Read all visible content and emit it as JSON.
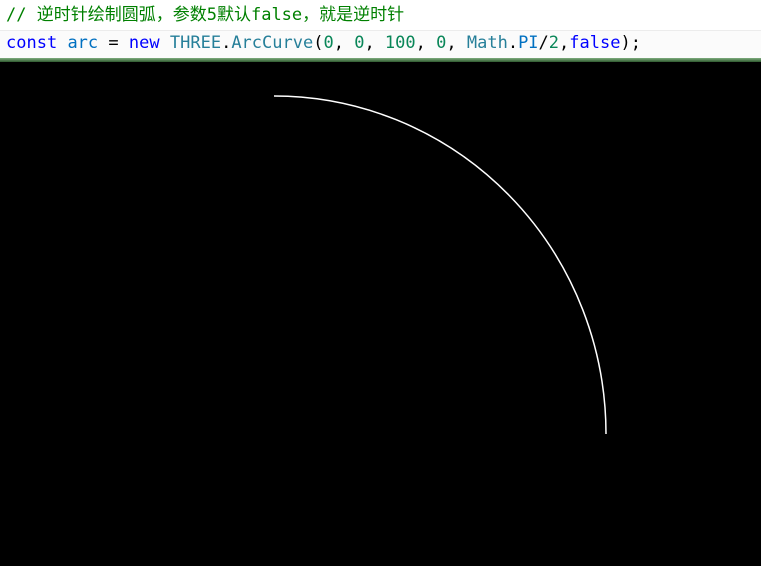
{
  "code": {
    "comment": {
      "prefix": "// ",
      "text1": "逆时针绘制圆弧，参数",
      "num": "5",
      "text2": "默认",
      "kw": "false",
      "text3": "，就是逆时针"
    },
    "statement": {
      "keyword_const": "const",
      "var_name": "arc",
      "equals": "=",
      "keyword_new": "new",
      "namespace": "THREE",
      "dot1": ".",
      "class_name": "ArcCurve",
      "open_paren": "(",
      "arg1": "0",
      "arg2": "0",
      "arg3": "100",
      "arg4": "0",
      "math_obj": "Math",
      "dot2": ".",
      "math_prop": "PI",
      "slash": "/",
      "divisor": "2",
      "comma": ",",
      "last_arg": "false",
      "close": ");"
    }
  },
  "scene": {
    "background": "#000000",
    "arc_color": "#ffffff",
    "axes": {
      "x_color": "#ff4a2a",
      "y_color": "#7ad12a",
      "z_color": "#2a8cff"
    }
  },
  "colors": {
    "comment": "#008000",
    "keyword": "#0000ff",
    "variable": "#0070c1",
    "namespace": "#267f99",
    "function": "#795e26",
    "number": "#098658",
    "text": "#000000",
    "editor_bg": "#ffffff"
  }
}
